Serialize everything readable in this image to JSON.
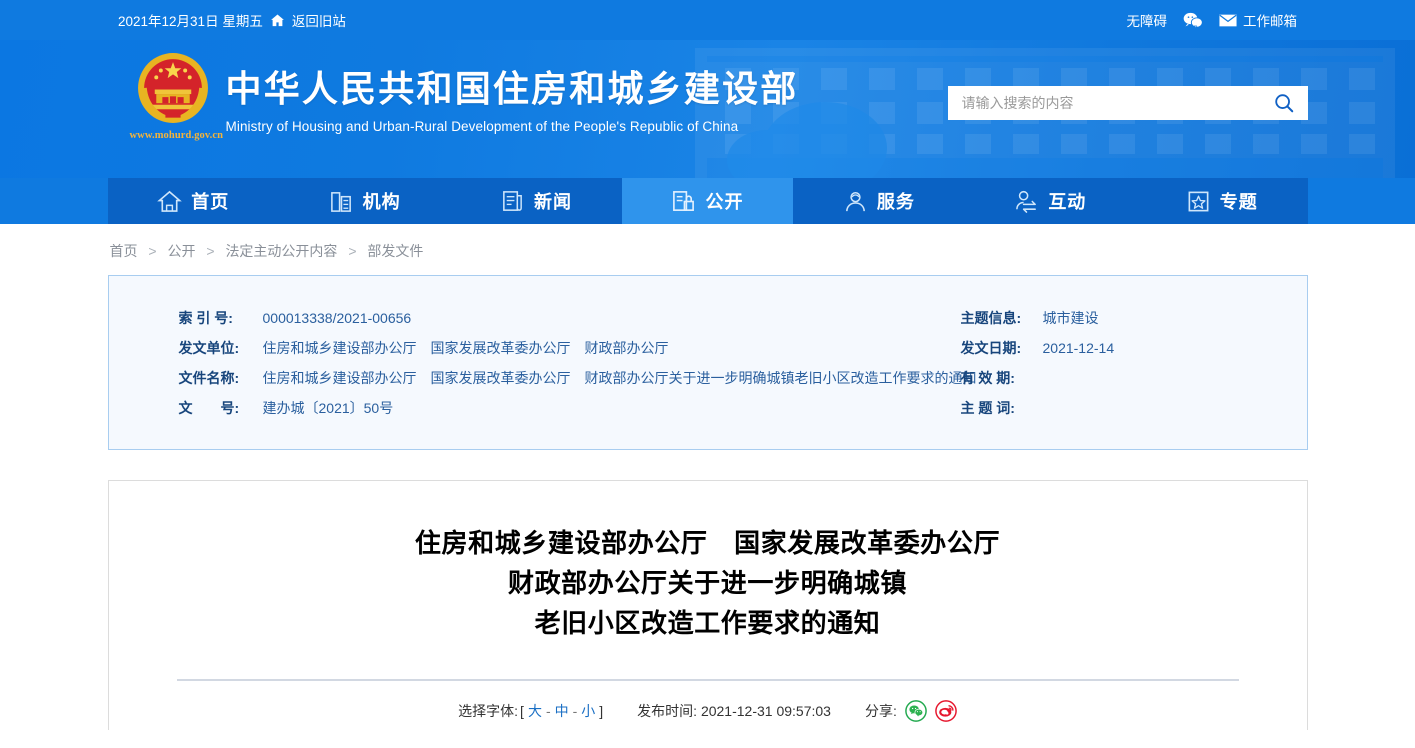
{
  "topbar": {
    "date": "2021年12月31日 星期五",
    "home_icon": "home-icon",
    "old_site_label": "返回旧站",
    "accessibility_label": "无障碍",
    "wechat_icon": "wechat-icon",
    "mail_icon": "mail-icon",
    "work_mail_label": "工作邮箱"
  },
  "banner": {
    "emblem_icon": "national-emblem-icon",
    "site_url": "www.mohurd.gov.cn",
    "title_cn": "中华人民共和国住房和城乡建设部",
    "title_en": "Ministry of Housing and Urban-Rural Development of the People's Republic of China",
    "search": {
      "placeholder": "请输入搜索的内容",
      "value": "",
      "icon": "search-icon"
    }
  },
  "nav": {
    "items": [
      {
        "label": "首页",
        "icon": "home-outline-icon",
        "active": false
      },
      {
        "label": "机构",
        "icon": "building-icon",
        "active": false
      },
      {
        "label": "新闻",
        "icon": "newspaper-icon",
        "active": false
      },
      {
        "label": "公开",
        "icon": "document-lock-icon",
        "active": true
      },
      {
        "label": "服务",
        "icon": "person-service-icon",
        "active": false
      },
      {
        "label": "互动",
        "icon": "person-exchange-icon",
        "active": false
      },
      {
        "label": "专题",
        "icon": "star-box-icon",
        "active": false
      }
    ]
  },
  "breadcrumb": {
    "separator": ">",
    "items": [
      "首页",
      "公开",
      "法定主动公开内容",
      "部发文件"
    ]
  },
  "meta": {
    "left": [
      {
        "label": "索 引 号:",
        "value": "000013338/2021-00656"
      },
      {
        "label": "发文单位:",
        "value": "住房和城乡建设部办公厅　国家发展改革委办公厅　财政部办公厅"
      },
      {
        "label": "文件名称:",
        "value": "住房和城乡建设部办公厅　国家发展改革委办公厅　财政部办公厅关于进一步明确城镇老旧小区改造工作要求的通知"
      },
      {
        "label": "文　　号:",
        "value": "建办城〔2021〕50号"
      }
    ],
    "right": [
      {
        "label": "主题信息:",
        "value": "城市建设"
      },
      {
        "label": "发文日期:",
        "value": "2021-12-14"
      },
      {
        "label": "有 效 期:",
        "value": ""
      },
      {
        "label": "主 题 词:",
        "value": ""
      }
    ]
  },
  "article": {
    "title_lines": [
      "住房和城乡建设部办公厅　国家发展改革委办公厅",
      "财政部办公厅关于进一步明确城镇",
      "老旧小区改造工作要求的通知"
    ],
    "toolbar": {
      "font_label": "选择字体:",
      "bracket_open": "[",
      "bracket_close": "]",
      "font_large": "大",
      "font_medium": "中",
      "font_small": "小",
      "dash": "-",
      "pubtime_label": "发布时间:",
      "pubtime_value": "2021-12-31 09:57:03",
      "share_label": "分享:",
      "share_items": [
        {
          "name": "wechat-share-icon",
          "color": "#22a94f"
        },
        {
          "name": "weibo-share-icon",
          "color": "#e6162d"
        }
      ]
    }
  },
  "colors": {
    "brand_blue": "#0f7ae0",
    "nav_blue": "#0a62c4",
    "nav_active": "#2f94ec",
    "meta_bg": "#f5f9fe",
    "meta_border": "#a8cdf0",
    "link_blue": "#1a6fc4",
    "emblem_gold": "#f4b43a"
  }
}
